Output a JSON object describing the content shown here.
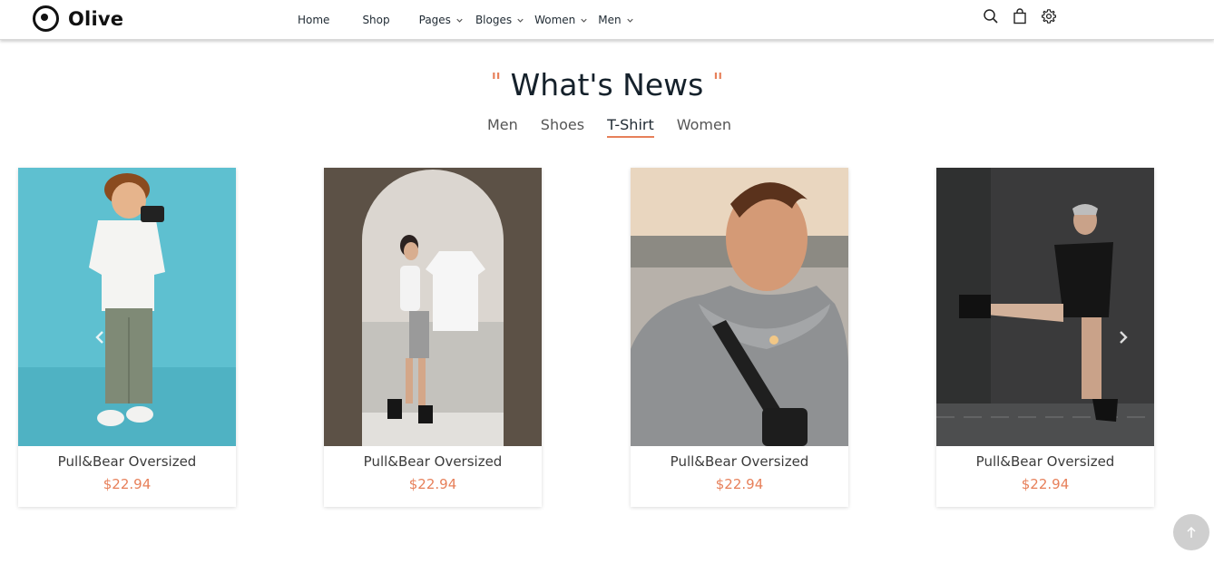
{
  "brand": {
    "name": "Olive"
  },
  "nav": {
    "items": [
      {
        "label": "Home",
        "dropdown": false
      },
      {
        "label": "Shop",
        "dropdown": false
      },
      {
        "label": "Pages",
        "dropdown": true
      },
      {
        "label": "Bloges",
        "dropdown": true
      },
      {
        "label": "Women",
        "dropdown": true
      },
      {
        "label": "Men",
        "dropdown": true
      }
    ]
  },
  "header_icons": [
    "search-icon",
    "shopping-bag-icon",
    "gear-icon"
  ],
  "section": {
    "quote_open": "\"",
    "title": "What's News",
    "quote_close": "\"",
    "tabs": [
      {
        "label": "Men",
        "active": false
      },
      {
        "label": "Shoes",
        "active": false
      },
      {
        "label": "T-Shirt",
        "active": true
      },
      {
        "label": "Women",
        "active": false
      }
    ]
  },
  "products": [
    {
      "name": "Pull&Bear Oversized",
      "price": "$22.94"
    },
    {
      "name": "Pull&Bear Oversized",
      "price": "$22.94"
    },
    {
      "name": "Pull&Bear Oversized",
      "price": "$22.94"
    },
    {
      "name": "Pull&Bear Oversized",
      "price": "$22.94"
    }
  ],
  "colors": {
    "accent": "#e7805a",
    "text": "#1f2a33"
  }
}
